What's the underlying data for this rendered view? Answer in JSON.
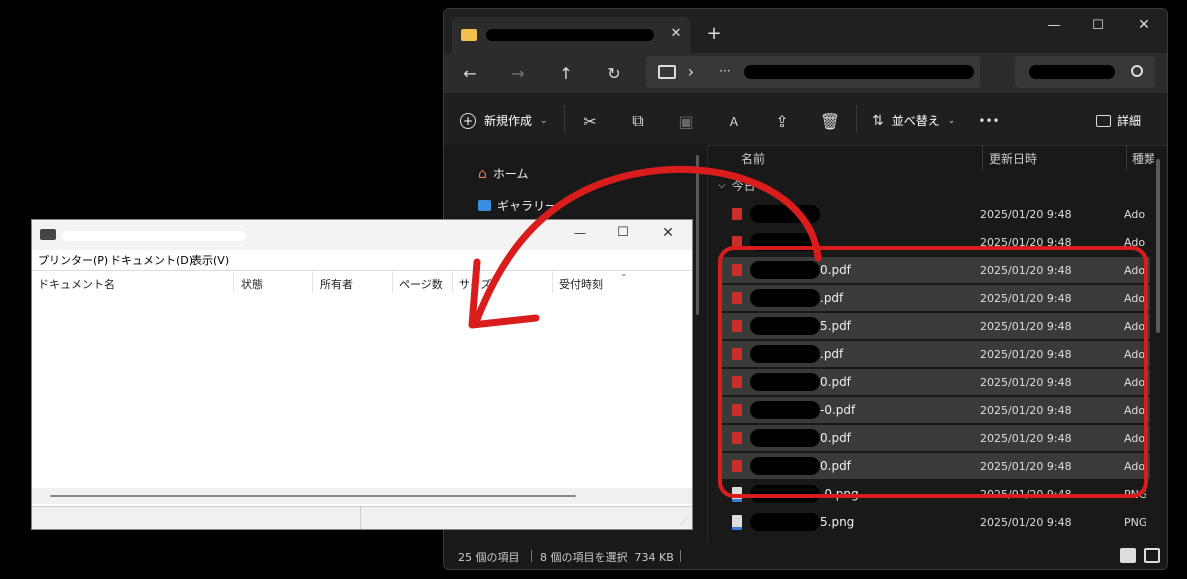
{
  "explorer": {
    "new_tab": "+",
    "window_controls": {
      "minimize": "—",
      "maximize": "☐",
      "close": "✕"
    },
    "nav": {
      "back": "←",
      "forward": "→",
      "up": "↑",
      "refresh": "↻",
      "chevron": "›",
      "more": "···"
    },
    "toolbar": {
      "new_label": "新規作成",
      "sort_label": "並べ替え",
      "more": "•••",
      "details_label": "詳細"
    },
    "sidebar": {
      "items": [
        {
          "label": "ホーム",
          "icon": "home-icon"
        },
        {
          "label": "ギャラリー",
          "icon": "gallery-icon"
        }
      ]
    },
    "columns": {
      "name": "名前",
      "date": "更新日時",
      "type": "種類"
    },
    "group_label": "今日",
    "rows": [
      {
        "name": "",
        "date": "2025/01/20 9:48",
        "type": "Ado",
        "icon": "pdf",
        "selected": false
      },
      {
        "name": "",
        "date": "2025/01/20 9:48",
        "type": "Ado",
        "icon": "pdf",
        "selected": false
      },
      {
        "name": "0.pdf",
        "date": "2025/01/20 9:48",
        "type": "Ado",
        "icon": "pdf",
        "selected": true
      },
      {
        "name": ".pdf",
        "date": "2025/01/20 9:48",
        "type": "Ado",
        "icon": "pdf",
        "selected": true
      },
      {
        "name": "5.pdf",
        "date": "2025/01/20 9:48",
        "type": "Ado",
        "icon": "pdf",
        "selected": true
      },
      {
        "name": ".pdf",
        "date": "2025/01/20 9:48",
        "type": "Ado",
        "icon": "pdf",
        "selected": true
      },
      {
        "name": "0.pdf",
        "date": "2025/01/20 9:48",
        "type": "Ado",
        "icon": "pdf",
        "selected": true
      },
      {
        "name": "-0.pdf",
        "date": "2025/01/20 9:48",
        "type": "Ado",
        "icon": "pdf",
        "selected": true
      },
      {
        "name": "0.pdf",
        "date": "2025/01/20 9:48",
        "type": "Ado",
        "icon": "pdf",
        "selected": true
      },
      {
        "name": "0.pdf",
        "date": "2025/01/20 9:48",
        "type": "Ado",
        "icon": "pdf",
        "selected": true
      },
      {
        "name": "-0.png",
        "date": "2025/01/20 9:48",
        "type": "PNG",
        "icon": "png",
        "selected": false
      },
      {
        "name": "5.png",
        "date": "2025/01/20 9:48",
        "type": "PNG",
        "icon": "png",
        "selected": false
      }
    ],
    "status": {
      "count": "25 個の項目",
      "selection": "8 個の項目を選択  734 KB"
    }
  },
  "printer": {
    "window_controls": {
      "minimize": "—",
      "maximize": "☐",
      "close": "✕"
    },
    "menu": [
      "プリンター(P)",
      "ドキュメント(D)",
      "表示(V)"
    ],
    "columns": [
      "ドキュメント名",
      "状態",
      "所有者",
      "ページ数",
      "サイズ",
      "受付時刻"
    ]
  },
  "colors": {
    "annotation_red": "#d91d1d",
    "selection": "#3a3a3a",
    "pdf_icon": "#c9302c"
  }
}
